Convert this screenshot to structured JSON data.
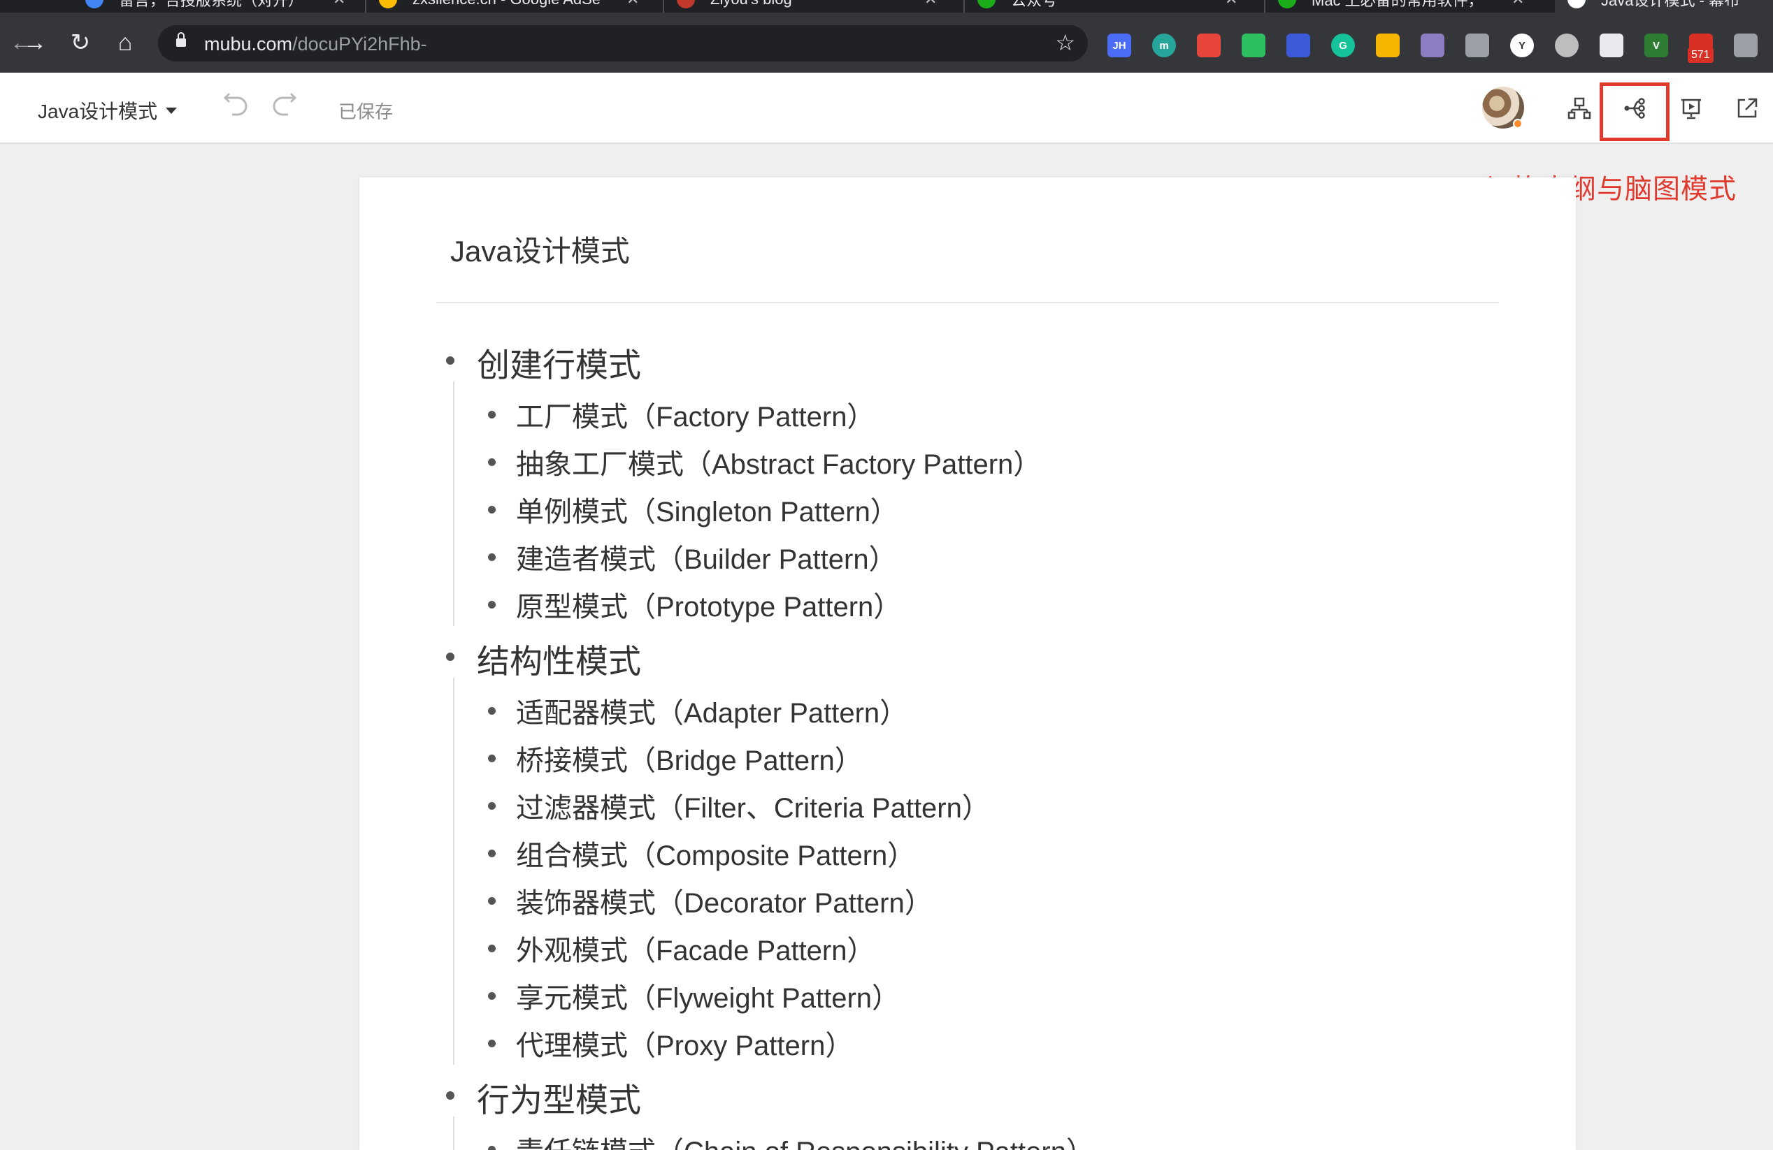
{
  "browser": {
    "tabs": [
      {
        "title": "留言，合授版系统（对开）",
        "icon": "bell-icon",
        "color": "#4285f4"
      },
      {
        "title": "zxsilence.cn - Google AdSe",
        "icon": "adsense-icon",
        "color": "#fbbc04"
      },
      {
        "title": "Ziyou's blog",
        "icon": "blog-icon",
        "color": "#c0392b"
      },
      {
        "title": "公众号",
        "icon": "wechat-mp-icon",
        "color": "#1aad19"
      },
      {
        "title": "Mac 上必备的常用软件，",
        "icon": "wechat-icon",
        "color": "#1aad19"
      },
      {
        "title": "Java设计模式 - 幕布",
        "icon": "mubu-icon",
        "color": "#ffffff"
      }
    ],
    "close_glyph": "✕",
    "url_host": "mubu.com",
    "url_path": "/docuPYi2hFhb-",
    "nav": {
      "back": "←",
      "forward": "→",
      "reload": "↻",
      "home": "⌂",
      "star": "☆"
    },
    "extensions": [
      {
        "name": "jh-extension-icon",
        "label": "JH",
        "color": "#4a6cf7"
      },
      {
        "name": "m-extension-icon",
        "label": "m",
        "color": "#26a69a"
      },
      {
        "name": "network-extension-icon",
        "label": "",
        "color": "#e8453c"
      },
      {
        "name": "evernote-extension-icon",
        "label": "",
        "color": "#2dbe60"
      },
      {
        "name": "translate-extension-icon",
        "label": "",
        "color": "#3b5bdb"
      },
      {
        "name": "grammarly-extension-icon",
        "label": "G",
        "color": "#15c39a"
      },
      {
        "name": "grid-extension-icon",
        "label": "",
        "color": "#f4b400"
      },
      {
        "name": "github-cat-extension-icon",
        "label": "",
        "color": "#8e7cc3"
      },
      {
        "name": "chart-extension-icon",
        "label": "",
        "color": "#9aa0a6"
      },
      {
        "name": "yandex-extension-icon",
        "label": "Y",
        "color": "#ffffff"
      },
      {
        "name": "circle-extension-icon",
        "label": "",
        "color": "#bdbdbd"
      },
      {
        "name": "shield-extension-icon",
        "label": "",
        "color": "#e8eaed"
      },
      {
        "name": "v-extension-icon",
        "label": "V",
        "color": "#2e7d32"
      },
      {
        "name": "mail-extension-icon",
        "label": "",
        "color": "#d93025"
      },
      {
        "name": "puzzle-extension-icon",
        "label": "",
        "color": "#9aa0a6"
      }
    ],
    "mail_badge": "571"
  },
  "app": {
    "doc_title": "Java设计模式",
    "saved_status": "已保存",
    "annotation": "切换大纲与脑图模式",
    "highlight_color": "#e03a2e"
  },
  "document": {
    "heading": "Java设计模式",
    "groups": [
      {
        "title": "创建行模式",
        "items": [
          "工厂模式（Factory Pattern）",
          "抽象工厂模式（Abstract Factory Pattern）",
          "单例模式（Singleton Pattern）",
          "建造者模式（Builder Pattern）",
          "原型模式（Prototype Pattern）"
        ]
      },
      {
        "title": "结构性模式",
        "items": [
          "适配器模式（Adapter Pattern）",
          "桥接模式（Bridge Pattern）",
          "过滤器模式（Filter、Criteria Pattern）",
          "组合模式（Composite Pattern）",
          "装饰器模式（Decorator Pattern）",
          "外观模式（Facade Pattern）",
          "享元模式（Flyweight Pattern）",
          "代理模式（Proxy Pattern）"
        ]
      },
      {
        "title": "行为型模式",
        "items": [
          "责任链模式（Chain of Responsibility Pattern）"
        ]
      }
    ]
  }
}
